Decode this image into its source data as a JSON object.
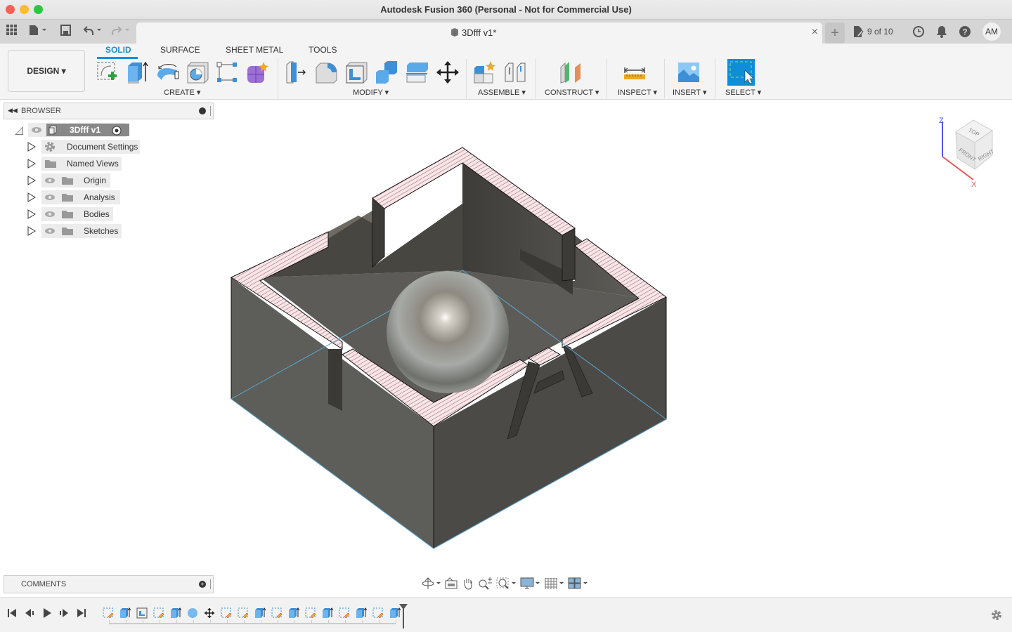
{
  "window": {
    "title": "Autodesk Fusion 360 (Personal - Not for Commercial Use)",
    "traffic_colors": {
      "close": "#fe5f57",
      "minimize": "#febc2e",
      "maximize": "#28c840"
    }
  },
  "tabbar": {
    "document_tab": "3Dfff v1*",
    "close_glyph": "×",
    "new_tab_glyph": "+",
    "version_counter": "9 of 10",
    "user_initials": "AM"
  },
  "toolbar": {
    "workspace": "DESIGN ▾",
    "tabs": [
      "SOLID",
      "SURFACE",
      "SHEET METAL",
      "TOOLS"
    ],
    "active_tab": "SOLID",
    "accent_color": "#1a8fd6",
    "groups": [
      {
        "label": "CREATE ▾",
        "icons": [
          "create-sketch-icon",
          "extrude-icon",
          "revolve-icon",
          "hole-icon",
          "pattern-icon",
          "create-form-icon"
        ]
      },
      {
        "label": "MODIFY ▾",
        "icons": [
          "press-pull-icon",
          "fillet-icon",
          "shell-icon",
          "combine-icon",
          "split-body-icon",
          "move-icon"
        ]
      },
      {
        "label": "ASSEMBLE ▾",
        "icons": [
          "new-component-icon",
          "joint-icon"
        ]
      },
      {
        "label": "CONSTRUCT ▾",
        "icons": [
          "offset-plane-icon"
        ]
      },
      {
        "label": "INSPECT ▾",
        "icons": [
          "measure-icon"
        ]
      },
      {
        "label": "INSERT ▾",
        "icons": [
          "insert-image-icon"
        ]
      },
      {
        "label": "SELECT ▾",
        "icons": [
          "window-select-icon"
        ]
      }
    ]
  },
  "browser": {
    "title": "BROWSER",
    "root": "3Dfff v1",
    "items": [
      {
        "label": "Document Settings",
        "icon": "gear-icon",
        "eye": false
      },
      {
        "label": "Named Views",
        "icon": "folder-icon",
        "eye": false
      },
      {
        "label": "Origin",
        "icon": "folder-icon",
        "eye": true
      },
      {
        "label": "Analysis",
        "icon": "folder-icon",
        "eye": true
      },
      {
        "label": "Bodies",
        "icon": "folder-icon",
        "eye": true
      },
      {
        "label": "Sketches",
        "icon": "folder-icon",
        "eye": true
      }
    ]
  },
  "viewcube": {
    "top": "TOP",
    "front": "FRONT",
    "right": "RIGHT",
    "axis_z": "Z",
    "axis_x": "X"
  },
  "comments": {
    "title": "COMMENTS"
  },
  "navbar": {
    "icons": [
      "orbit-icon",
      "look-at-icon",
      "pan-icon",
      "zoom-icon",
      "zoom-window-icon",
      "display-settings-icon",
      "grid-icon",
      "viewports-icon"
    ]
  },
  "timeline": {
    "controls": [
      "first-icon",
      "previous-icon",
      "play-icon",
      "next-icon",
      "last-icon"
    ],
    "features": [
      "sketch",
      "extrude",
      "shell",
      "sketch",
      "extrude",
      "sphere",
      "move",
      "sketch",
      "sketch",
      "extrude",
      "sketch",
      "extrude",
      "sketch",
      "extrude",
      "sketch",
      "extrude",
      "sketch",
      "extrude"
    ]
  }
}
